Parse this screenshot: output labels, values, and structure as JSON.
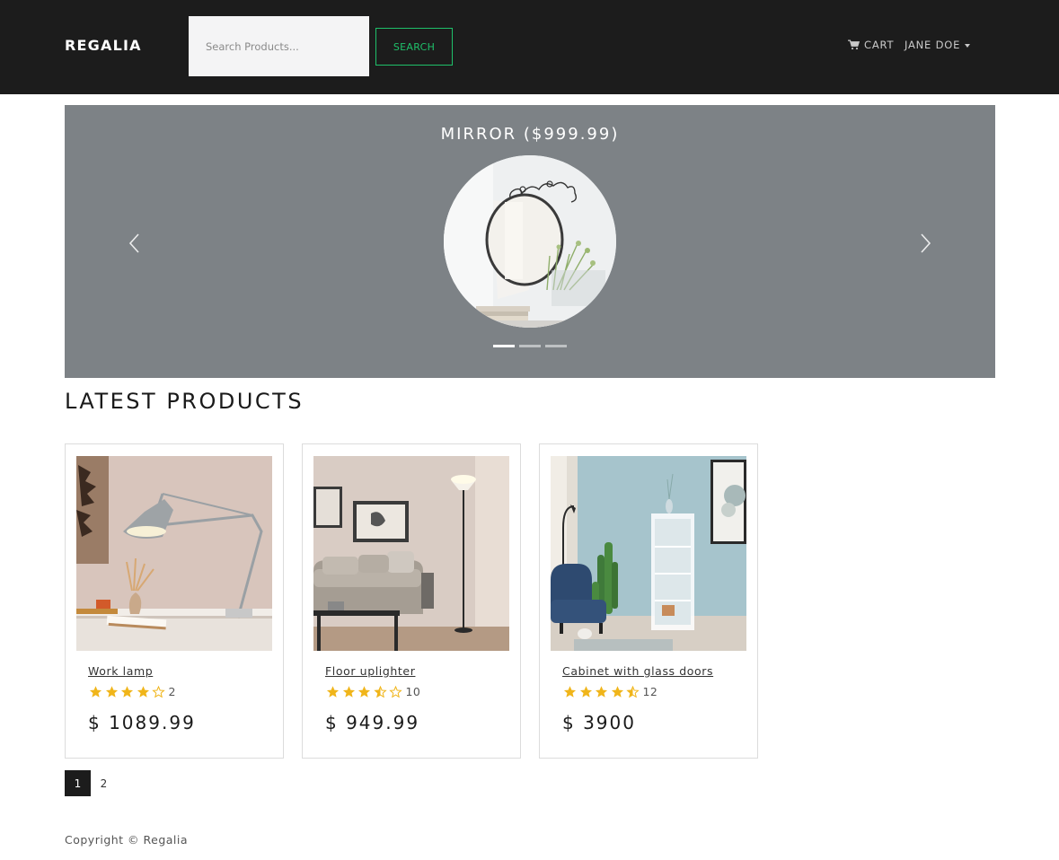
{
  "navbar": {
    "brand": "REGALIA",
    "search_placeholder": "Search Products...",
    "search_button": "SEARCH",
    "cart_label": "CART",
    "user_label": "JANE DOE",
    "cart_icon": "shopping-cart-icon",
    "accent_color": "#1fc06a"
  },
  "carousel": {
    "caption": "MIRROR ($999.99)",
    "image_alt": "mirror-photo",
    "slide_count": 3,
    "active_index": 0,
    "background": "#7d8286"
  },
  "latest": {
    "title": "LATEST PRODUCTS",
    "products": [
      {
        "name": "Work lamp",
        "rating": 4,
        "reviews": "2",
        "price": "$ 1089.99"
      },
      {
        "name": "Floor uplighter",
        "rating": 3.5,
        "reviews": "10",
        "price": "$ 949.99"
      },
      {
        "name": "Cabinet with glass doors",
        "rating": 4.5,
        "reviews": "12",
        "price": "$ 3900"
      }
    ]
  },
  "pagination": {
    "pages": [
      "1",
      "2"
    ],
    "active": "1"
  },
  "footer": {
    "copyright": "Copyright © Regalia"
  },
  "colors": {
    "star": "#f0b51a",
    "navbar": "#1c1c1c"
  }
}
